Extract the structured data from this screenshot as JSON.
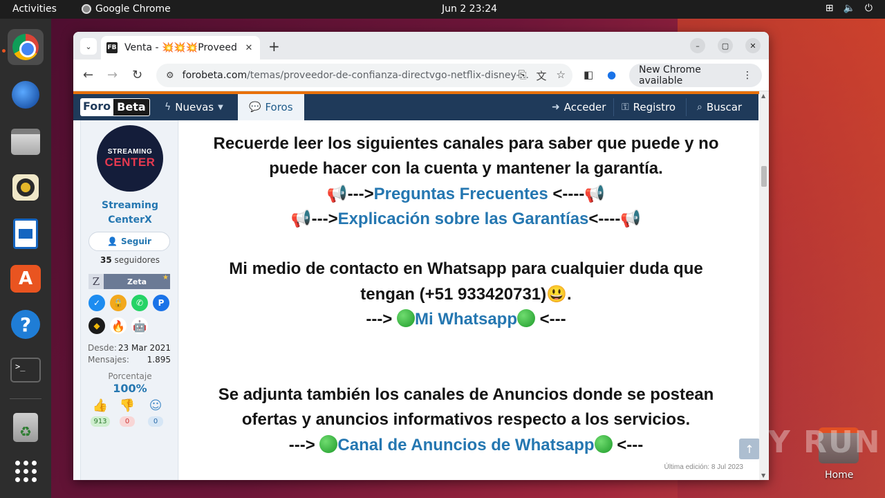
{
  "topbar": {
    "activities": "Activities",
    "app": "Google Chrome",
    "clock": "Jun 2  23:24"
  },
  "desktop": {
    "home_label": "Home",
    "watermark": "ANY RUN"
  },
  "browser": {
    "tab_title": "Venta - 💥💥💥Proveed",
    "favicon_text": "FB",
    "url_host": "forobeta.com",
    "url_path": "/temas/proveedor-de-confianza-directvgo-netflix-disney-...",
    "new_chrome_label": "New Chrome available"
  },
  "forum_nav": {
    "logo_a": "Foro",
    "logo_b": "Beta",
    "nuevas": "Nuevas",
    "foros": "Foros",
    "acceder": "Acceder",
    "registro": "Registro",
    "buscar": "Buscar"
  },
  "user": {
    "avatar_line1": "STREAMING",
    "avatar_line2": "CENTER",
    "name_line1": "Streaming",
    "name_line2": "CenterX",
    "follow_label": "Seguir",
    "followers_count": "35",
    "followers_label": " seguidores",
    "rank_letter": "Z",
    "rank_name": "Zeta",
    "desde_label": "Desde:",
    "desde_value": "23 Mar 2021",
    "mensajes_label": "Mensajes:",
    "mensajes_value": "1.895",
    "porcentaje_label": "Porcentaje",
    "porcentaje_value": "100%",
    "likes": "913",
    "dislikes": "0",
    "neutral": "0"
  },
  "post": {
    "line1": "Recuerde leer los siguientes canales para saber que puede y no",
    "line2": "puede hacer con la cuenta y mantener la garantía.",
    "line3_pre": "📢--->",
    "line3_link": "Preguntas Frecuentes",
    "line3_post": " <----📢",
    "line4_pre": "📢--->",
    "line4_link": "Explicación sobre las Garantías",
    "line4_post": "<----📢",
    "line5": "Mi medio de contacto en Whatsapp para cualquier duda que",
    "line6": "tengan (+51 933420731)😃.",
    "line7_pre": "---> ",
    "line7_link": "Mi Whatsapp",
    "line7_post": " <---",
    "line8": "Se adjunta también los canales de Anuncios donde se postean",
    "line9": "ofertas y anuncios informativos respecto a los servicios.",
    "line10_pre": "---> ",
    "line10_link": "Canal de Anuncios de Whatsapp",
    "line10_post": " <---",
    "last_edit": "Última edición: 8 Jul 2023"
  }
}
